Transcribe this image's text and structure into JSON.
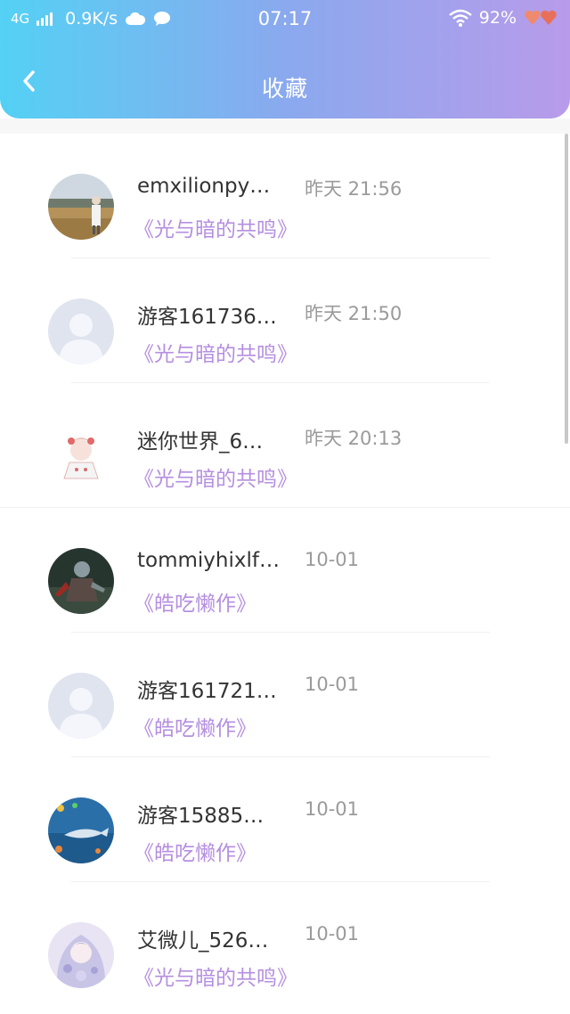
{
  "status_bar": {
    "network": "4G",
    "speed": "0.9K/s",
    "time": "07:17",
    "battery": "92%"
  },
  "header": {
    "title": "收藏"
  },
  "colors": {
    "gradient_start": "#54d1f5",
    "gradient_end": "#b89bea",
    "link": "#b58fe0"
  },
  "items": [
    {
      "username": "emxilionpy…",
      "time": "昨天 21:56",
      "work": "《光与暗的共鸣》",
      "avatar": "landscape-photo"
    },
    {
      "username": "游客161736…",
      "time": "昨天 21:50",
      "work": "《光与暗的共鸣》",
      "avatar": "default-user"
    },
    {
      "username": "迷你世界_6…",
      "time": "昨天 20:13",
      "work": "《光与暗的共鸣》",
      "avatar": "anime-character"
    },
    {
      "username": "tommiyhixlf…",
      "time": "10-01",
      "work": "《皓吃懒作》",
      "avatar": "dark-character"
    },
    {
      "username": "游客161721…",
      "time": "10-01",
      "work": "《皓吃懒作》",
      "avatar": "default-user"
    },
    {
      "username": "游客15885…",
      "time": "10-01",
      "work": "《皓吃懒作》",
      "avatar": "ocean-scene"
    },
    {
      "username": "艾微儿_526…",
      "time": "10-01",
      "work": "《光与暗的共鸣》",
      "avatar": "anime-girl"
    }
  ]
}
